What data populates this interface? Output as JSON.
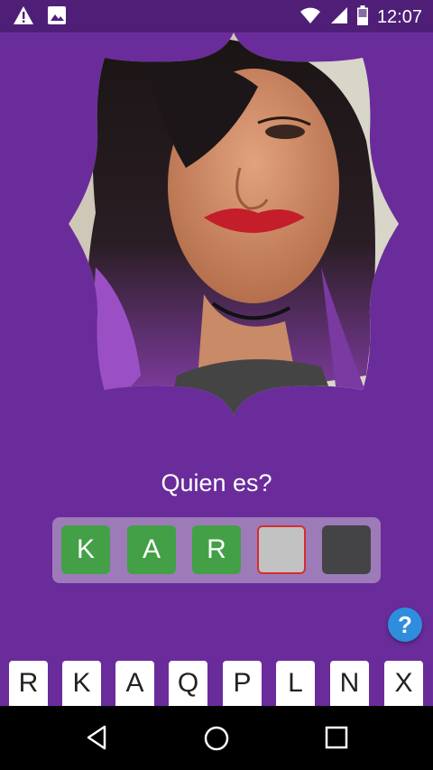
{
  "status_bar": {
    "time": "12:07",
    "icons": [
      "warning-icon",
      "image-icon",
      "wifi-icon",
      "signal-icon",
      "battery-icon"
    ]
  },
  "question": "Quien es?",
  "answer_slots": [
    {
      "letter": "K",
      "state": "filled"
    },
    {
      "letter": "A",
      "state": "filled"
    },
    {
      "letter": "R",
      "state": "filled"
    },
    {
      "letter": "",
      "state": "active"
    },
    {
      "letter": "",
      "state": "empty"
    }
  ],
  "help_button": "?",
  "keyboard_letters": [
    "R",
    "K",
    "A",
    "Q",
    "P",
    "L",
    "N",
    "X"
  ],
  "nav_icons": [
    "back-icon",
    "home-icon",
    "recents-icon"
  ],
  "colors": {
    "background": "#6a2c9b",
    "status_bar": "#4f1f78",
    "slot_filled": "#43a047",
    "slot_active_border": "#d32f2f",
    "help": "#2f8ddd"
  }
}
